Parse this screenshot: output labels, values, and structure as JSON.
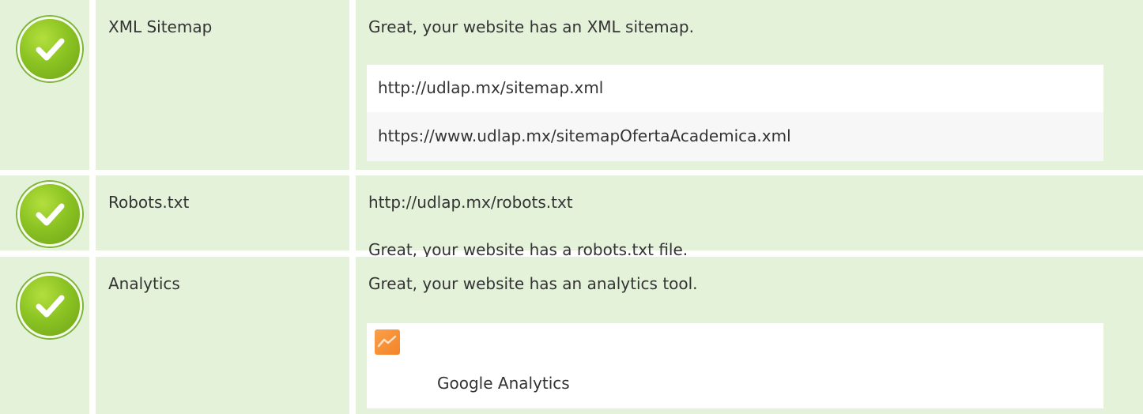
{
  "rows": [
    {
      "status_icon": "check-icon",
      "name": "XML Sitemap",
      "description": "Great, your website has an XML sitemap.",
      "sitemaps": [
        "http://udlap.mx/sitemap.xml",
        "https://www.udlap.mx/sitemapOfertaAcademica.xml"
      ]
    },
    {
      "status_icon": "check-icon",
      "name": "Robots.txt",
      "url": "http://udlap.mx/robots.txt",
      "description": "Great, your website has a robots.txt file."
    },
    {
      "status_icon": "check-icon",
      "name": "Analytics",
      "description": "Great, your website has an analytics tool.",
      "tools": [
        {
          "icon": "google-analytics-icon",
          "label": "Google Analytics"
        }
      ]
    }
  ],
  "colors": {
    "row_background": "#e4f2da",
    "check_green": "#8cc423",
    "analytics_orange": "#f58327"
  }
}
